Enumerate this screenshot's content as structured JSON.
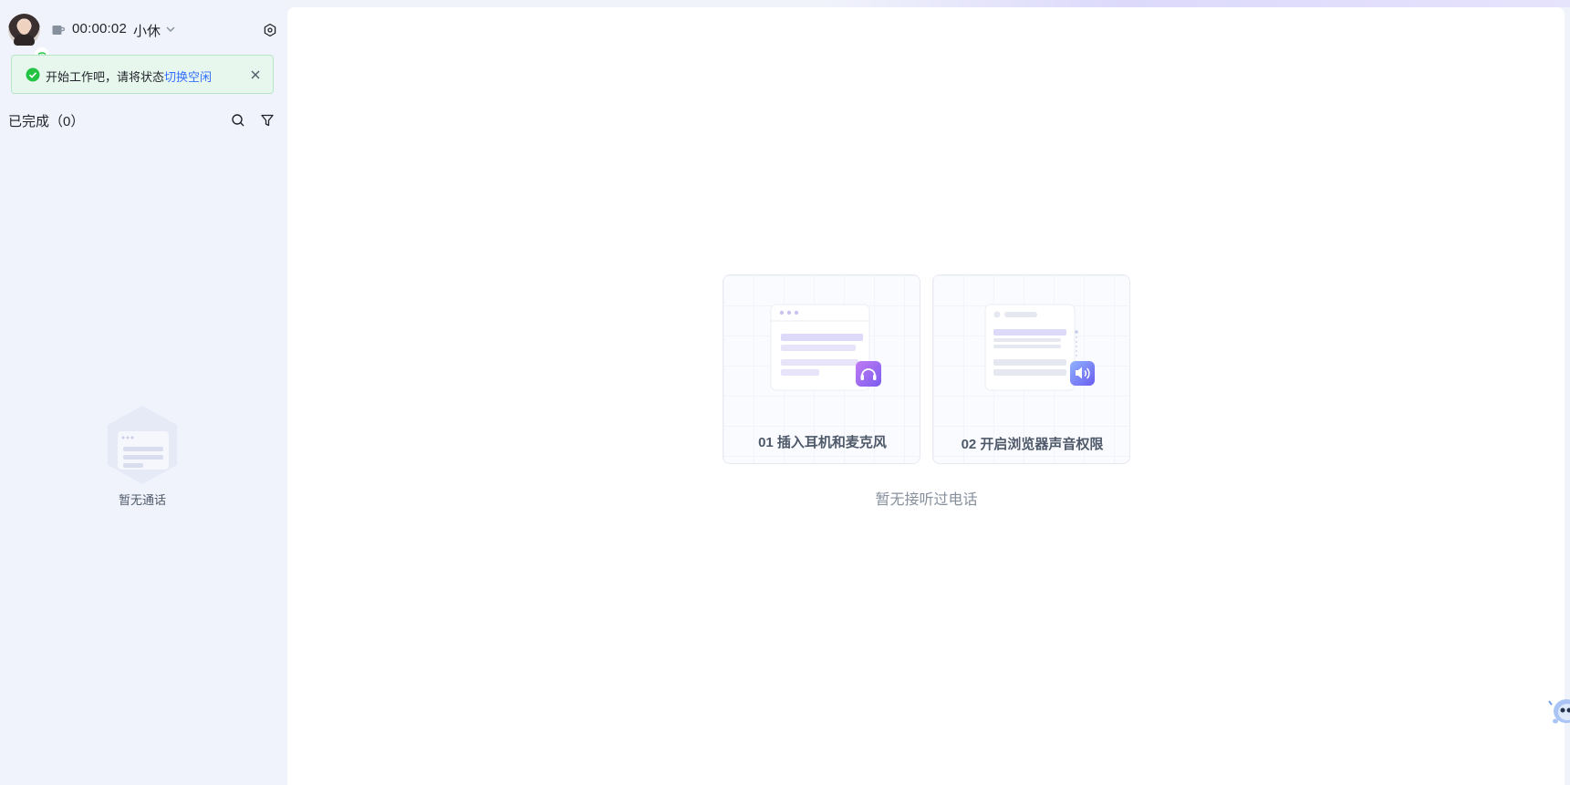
{
  "topbar": {
    "timer": "00:00:02",
    "status": "小休"
  },
  "notice": {
    "text": "开始工作吧，请将状态",
    "link": "切换空闲"
  },
  "list": {
    "header": "已完成（0）",
    "empty_text": "暂无通话"
  },
  "main": {
    "cards": [
      {
        "label": "01 插入耳机和麦克风",
        "icon": "headset-icon"
      },
      {
        "label": "02 开启浏览器声音权限",
        "icon": "speaker-icon"
      }
    ],
    "empty_text": "暂无接听过电话"
  },
  "colors": {
    "accent": "#3370ff",
    "success": "#23c343",
    "sidebar_bg": "#f1f3fc"
  }
}
